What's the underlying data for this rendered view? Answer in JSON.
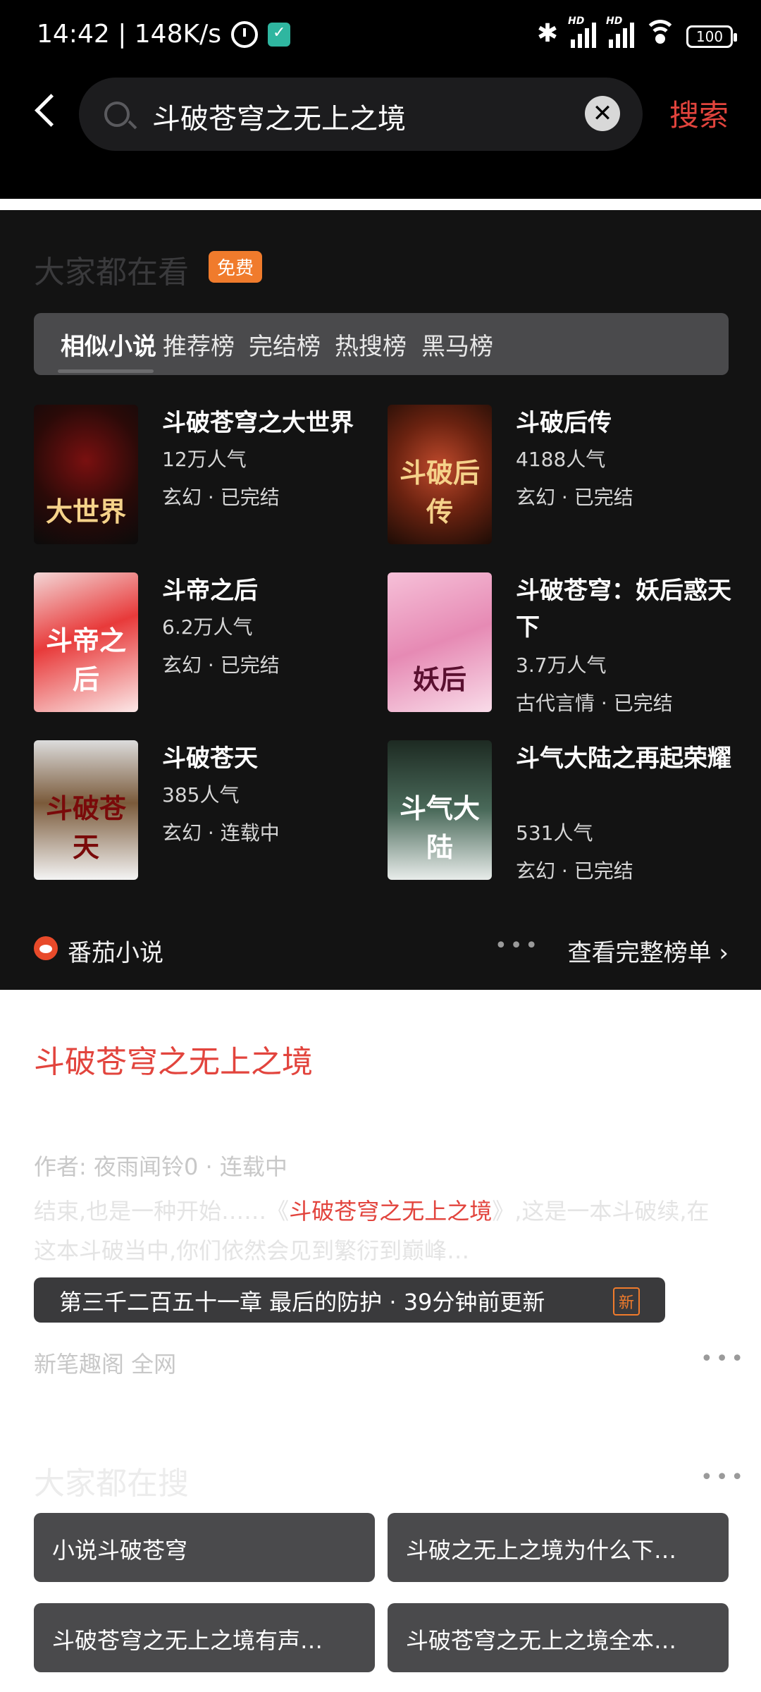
{
  "status_bar": {
    "time_speed": "14:42 | 148K/s",
    "battery": "100",
    "hd_label": "HD"
  },
  "header": {
    "search_query": "斗破苍穹之无上之境",
    "search_button": "搜索",
    "clear_icon": "close-circle-icon",
    "back_icon": "back-arrow-icon"
  },
  "everyone_watching": {
    "title": "大家都在看",
    "free_badge": "免费",
    "tabs": [
      {
        "label": "相似小说"
      },
      {
        "label": "推荐榜"
      },
      {
        "label": "完结榜"
      },
      {
        "label": "热搜榜"
      },
      {
        "label": "黑马榜"
      }
    ],
    "books": [
      {
        "title": "斗破苍穹之大世界",
        "popularity": "12万人气",
        "meta": "玄幻 · 已完结"
      },
      {
        "title": "斗破后传",
        "popularity": "4188人气",
        "meta": "玄幻 · 已完结"
      },
      {
        "title": "斗帝之后",
        "popularity": "6.2万人气",
        "meta": "玄幻 · 已完结"
      },
      {
        "title": "斗破苍穹：妖后惑天下",
        "popularity": "3.7万人气",
        "meta": "古代言情 · 已完结"
      },
      {
        "title": "斗破苍天",
        "popularity": "385人气",
        "meta": "玄幻 · 连载中"
      },
      {
        "title": "斗气大陆之再起荣耀",
        "popularity": "531人气",
        "meta": "玄幻 · 已完结"
      }
    ],
    "source_name": "番茄小说",
    "more_dots": "•••",
    "full_list_link": "查看完整榜单 ›"
  },
  "result": {
    "title": "斗破苍穹之无上之境",
    "author_line": "作者: 夜雨闻铃0 · 连载中",
    "desc_prefix": "结束,也是一种开始……《",
    "desc_highlight": "斗破苍穹之无上之境",
    "desc_suffix": "》,这是一本斗破续,在这本斗破当中,你们依然会见到繁衍到巅峰…",
    "latest_chapter": "第三千二百五十一章 最后的防护 · 39分钟前更新",
    "new_badge": "新",
    "sources": "新笔趣阁   全网",
    "more_dots": "•••"
  },
  "everyone_searching": {
    "title": "大家都在搜",
    "more_dots": "•••",
    "chips": [
      "小说斗破苍穹",
      "斗破之无上之境为什么下…",
      "斗破苍穹之无上之境有声…",
      "斗破苍穹之无上之境全本…"
    ]
  },
  "colors": {
    "accent_red": "#e2443d",
    "badge_orange": "#f07b2c",
    "card_dark": "#131313"
  }
}
